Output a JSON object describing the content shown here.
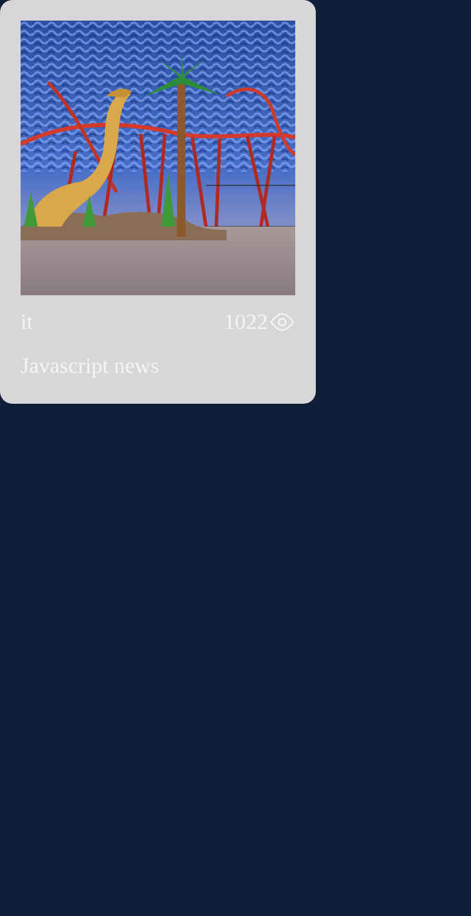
{
  "card": {
    "category": "it",
    "views": "1022",
    "title": "Javascript news",
    "image_icon": "theme-park-photo",
    "views_icon": "eye-icon"
  },
  "colors": {
    "background": "#0f1f38",
    "card": "#d8d6d9",
    "text": "#f5f5f7"
  }
}
